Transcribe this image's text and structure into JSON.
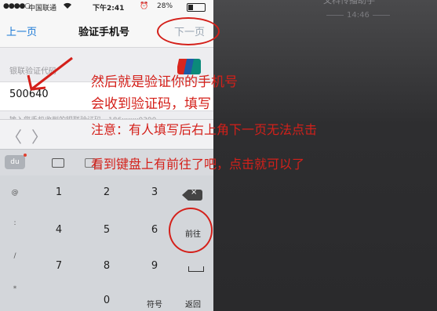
{
  "status_bar": {
    "signal": "●●●●○",
    "carrier": "中国联通",
    "wifi_icon": "wifi-icon",
    "time": "下午2:41",
    "alarm": "⏰",
    "battery": "28%"
  },
  "nav_bar": {
    "back_label": "上一页",
    "title": "验证手机号",
    "next_label": "下一页"
  },
  "bank_logo": {
    "text": "UnionPay 银联"
  },
  "form": {
    "label": "银联验证代码",
    "value": "500640",
    "hint": "输入您手机收到的银联验证码，186xxxx0390"
  },
  "accessory": {
    "prev": "〈",
    "next": "〉"
  },
  "keyboard_bar": {
    "logo": "du"
  },
  "keypad": {
    "rows": [
      [
        "@",
        "1",
        "2",
        "3",
        "⌫"
      ],
      [
        ":",
        "4",
        "5",
        "6",
        "前往"
      ],
      [
        "/",
        "7",
        "8",
        "9",
        "␣"
      ],
      [
        "*",
        "",
        "0",
        "符号",
        "返回"
      ]
    ]
  },
  "right_panel": {
    "title": "文科传播助手",
    "time": "14:46"
  },
  "annotation": {
    "line1": "然后就是验证你的手机号",
    "line2": "会收到验证码，填写",
    "line3": "注意：有人填写后右上角下一页无法点击",
    "line4": "看到键盘上有前往了吧，点击就可以了"
  },
  "colors": {
    "accent_blue": "#1a78d6",
    "annotation_red": "#d4201a"
  }
}
